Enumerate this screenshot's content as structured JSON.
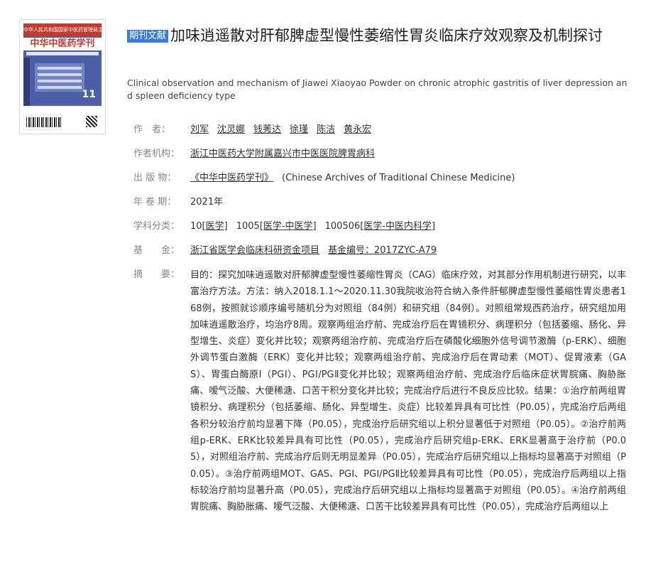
{
  "cover": {
    "top_text": "中华人民共和国国家中医药管理局主管",
    "title": "中华中医药学刊",
    "issue": "11"
  },
  "article": {
    "tag": "期刊文献",
    "title_cn": "加味逍遥散对肝郁脾虚型慢性萎缩性胃炎临床疗效观察及机制探讨",
    "title_en": "Clinical observation and mechanism of Jiawei Xiaoyao Powder on chronic atrophic gastritis of liver depression and spleen deficiency type"
  },
  "meta": {
    "authors_label": "作　者：",
    "authors": [
      "刘军",
      "沈灵娜",
      "钱莠达",
      "徐瑾",
      "陈洁",
      "黄永宏"
    ],
    "institution_label": "作者机构：",
    "institution": "浙江中医药大学附属嘉兴市中医医院脾胃病科",
    "publication_label": "出 版 物：",
    "publication": "《中华中医药学刊》",
    "publication_en": "(Chinese Archives of Traditional Chinese Medicine)",
    "year_label": "年 卷 期：",
    "year": "2021年",
    "subject_label": "学科分类：",
    "subject": [
      {
        "code": "10",
        "name": "[医学]"
      },
      {
        "code": "1005",
        "name": "[医学-中医学]"
      },
      {
        "code": "100506",
        "name": "[医学-中医内科学]"
      }
    ],
    "fund_label": "基　　金：",
    "fund_name": "浙江省医学会临床科研资金项目",
    "fund_code": "基金编号：2017ZYC-A79",
    "abstract_label": "摘　　要：",
    "abstract": "目的：探究加味逍遥散对肝郁脾虚型慢性萎缩性胃炎（CAG）临床疗效，对其部分作用机制进行研究，以丰富治疗方法。方法：纳入2018.1.1～2020.11.30我院收治符合纳入条件肝郁脾虚型慢性萎缩性胃炎患者168例，按照就诊顺序编号随机分为对照组（84例）和研究组（84例）。对照组常规西药治疗，研究组加用加味逍遥散治疗，均治疗8周。观察两组治疗前、完成治疗后在胃镜积分、病理积分（包括萎缩、肠化、异型增生、炎症）变化并比较；观察两组治疗前、完成治疗后在磷酸化细胞外信号调节激酶（p-ERK）、细胞外调节蛋白激酶（ERK）变化并比较；观察两组治疗前、完成治疗后在胃动素（MOT）、促胃液素（GAS）、胃蛋白酶原Ⅰ（PGⅠ）、PGⅠ/PGⅡ变化并比较；观察两组治疗前、完成治疗后临床症状胃脘痛、胸胁胀痛、嗳气泛酸、大便稀溏、口苦干积分变化并比较；完成治疗后进行不良反应比较。结果：①治疗前两组胃镜积分、病理积分（包括萎缩、肠化、异型增生、炎症）比较差异具有可比性（P0.05），完成治疗后两组各积分较治疗前均显著下降（P0.05），完成治疗后研究组以上积分显著低于对照组（P0.05）。②治疗前两组p-ERK、ERK比较差异具有可比性（P0.05），完成治疗后研究组p-ERK、ERK显著高于治疗前（P0.05），对照组治疗前、完成治疗后则无明显差异（P0.05），完成治疗后研究组以上指标均显著高于对照组（P0.05）。③治疗前两组MOT、GAS、PGⅠ、PGⅠ/PGⅡ比较差异具有可比性（P0.05），完成治疗后两组以上指标较治疗前均显著升高（P0.05），完成治疗后研究组以上指标均显著高于对照组（P0.05）。④治疗前两组胃脘痛、胸胁胀痛、嗳气泛酸、大便稀溏、口苦干比较差异具有可比性（P0.05），完成治疗后两组以上"
  }
}
